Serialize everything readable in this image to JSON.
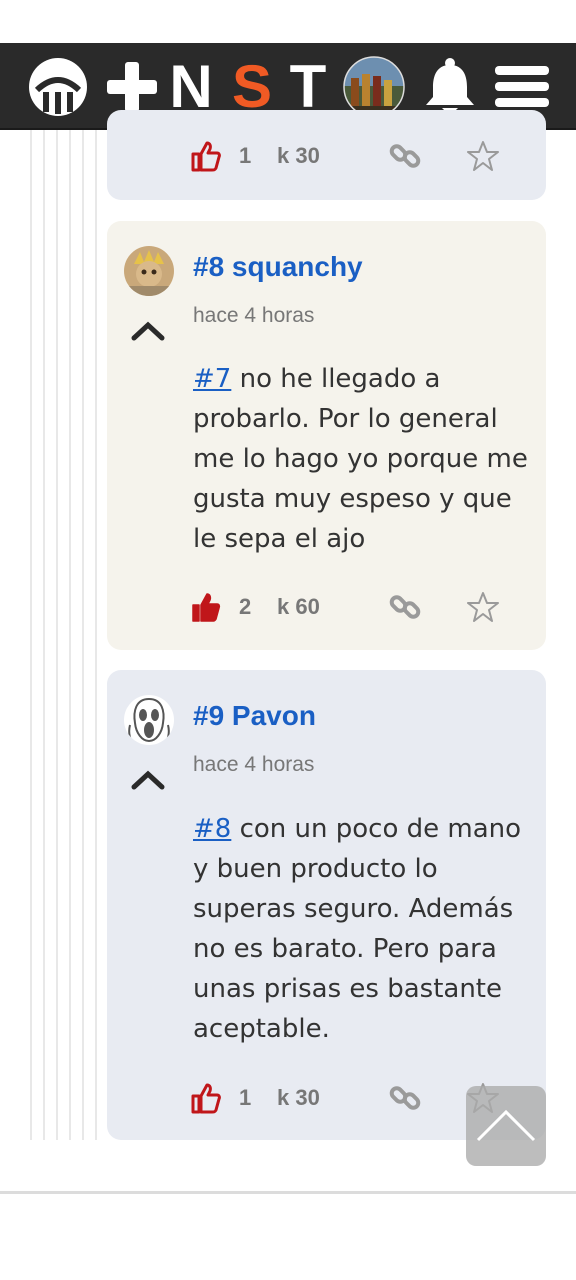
{
  "nav": {
    "letters": [
      "N",
      "S",
      "T"
    ],
    "active_letter": "S",
    "accent_color": "#f05a24",
    "icons": [
      "logo-icon",
      "plus-icon",
      "profile-avatar",
      "bell-icon",
      "menu-icon"
    ]
  },
  "comments": [
    {
      "likes": "1",
      "karma": "k 30",
      "liked": false
    },
    {
      "number_author": "#8 squanchy",
      "time": "hace 4 horas",
      "reply_ref": "#7",
      "body": " no he llegado a probarlo. Por lo general me lo hago yo porque me gusta muy espeso y que le sepa el ajo",
      "likes": "2",
      "karma": "k 60",
      "liked": true
    },
    {
      "number_author": "#9 Pavon",
      "time": "hace 4 horas",
      "reply_ref": "#8",
      "body": " con un poco de mano y buen producto lo superas seguro. Además no es barato. Pero para unas prisas es bastante aceptable.",
      "likes": "1",
      "karma": "k 30",
      "liked": false
    }
  ],
  "colors": {
    "link": "#1a5fc4",
    "like_red": "#c0161a",
    "blue_card": "#e8ebf2",
    "cream_card": "#f5f3ec"
  }
}
